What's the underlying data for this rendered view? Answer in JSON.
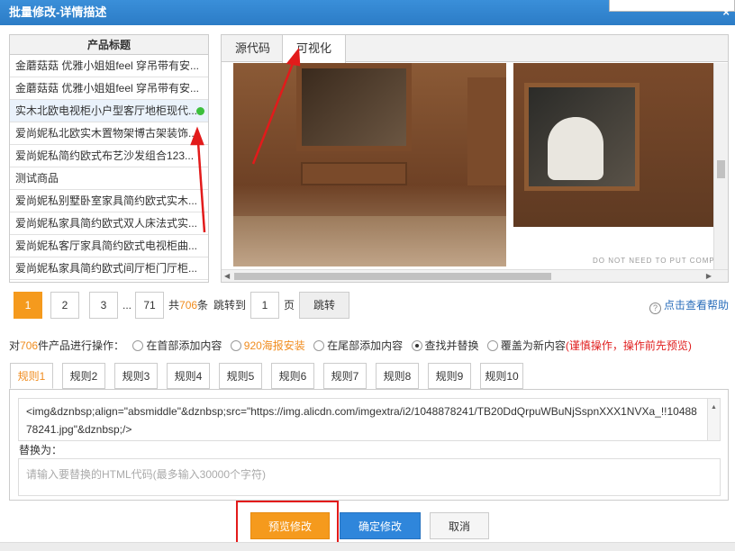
{
  "window": {
    "title": "批量修改-详情描述",
    "close_glyph": "×"
  },
  "product_list": {
    "header": "产品标题",
    "items": [
      {
        "label": "金蘑菇菇 优雅小姐姐feel 穿吊带有安..."
      },
      {
        "label": "金蘑菇菇 优雅小姐姐feel 穿吊带有安..."
      },
      {
        "label": "实木北欧电视柜小户型客厅地柜现代...",
        "selected": true,
        "status_color": "#3cbf3c"
      },
      {
        "label": "爱尚妮私北欧实木置物架博古架装饰..."
      },
      {
        "label": "爱尚妮私简约欧式布艺沙发组合123..."
      },
      {
        "label": "测试商品"
      },
      {
        "label": "爱尚妮私别墅卧室家具简约欧式实木..."
      },
      {
        "label": "爱尚妮私家具简约欧式双人床法式实..."
      },
      {
        "label": "爱尚妮私客厅家具简约欧式电视柜曲..."
      },
      {
        "label": "爱尚妮私家具简约欧式间厅柜门厅柜..."
      }
    ]
  },
  "preview": {
    "tabs": [
      {
        "label": "源代码"
      },
      {
        "label": "可视化",
        "active": true
      }
    ],
    "watermark": "DO NOT NEED TO PUT COMP"
  },
  "pager": {
    "pages": [
      "1",
      "2",
      "3"
    ],
    "ellipsis": "...",
    "last_page": "71",
    "total_prefix": "共",
    "total_count": "706",
    "total_suffix": "条",
    "goto_label": "跳转到",
    "goto_value": "1",
    "page_unit": "页",
    "goto_button": "跳转"
  },
  "help_link": "点击查看帮助",
  "operations": {
    "prefix": "对",
    "count": "706",
    "suffix": "件产品进行操作：",
    "options": [
      {
        "label": "在首部添加内容"
      },
      {
        "label": "920海报安装",
        "highlight": true
      },
      {
        "label": "在尾部添加内容"
      },
      {
        "label": "查找并替换",
        "checked": true
      },
      {
        "label": "覆盖为新内容"
      }
    ],
    "warning": "(谨慎操作，操作前先预览)"
  },
  "rules": {
    "tabs": [
      "规则1",
      "规则2",
      "规则3",
      "规则4",
      "规则5",
      "规则6",
      "规则7",
      "规则8",
      "规则9",
      "规则10"
    ],
    "find_code": "<img&dznbsp;align=\"absmiddle\"&dznbsp;src=\"https://img.alicdn.com/imgextra/i2/1048878241/TB20DdQrpuWBuNjSspnXXX1NVXa_!!1048878241.jpg\"&dznbsp;/>",
    "replace_label": "替换为：",
    "replace_placeholder": "请输入要替换的HTML代码(最多输入30000个字符)"
  },
  "footer": {
    "preview_button": "预览修改",
    "confirm_button": "确定修改",
    "cancel_button": "取消"
  },
  "colors": {
    "accent_orange": "#f59a1d",
    "primary_blue": "#2f86db",
    "annotation_red": "#e21b1b",
    "title_blue": "#2c7cc6"
  }
}
